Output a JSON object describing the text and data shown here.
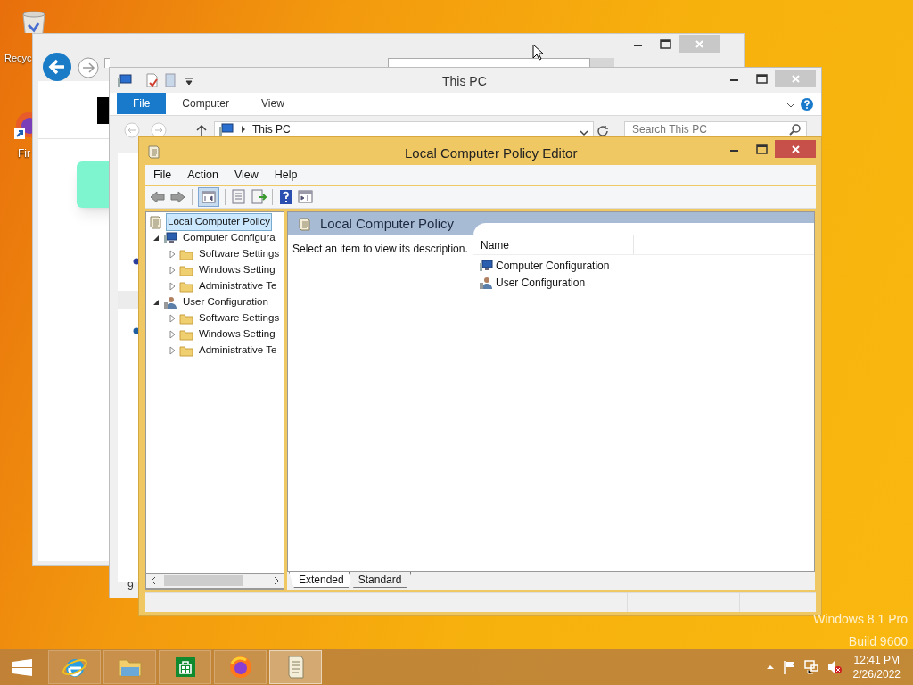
{
  "desktop_icons": [
    {
      "label": "Recyc"
    },
    {
      "label": "Fir"
    }
  ],
  "explorer_window": {
    "title": "This PC",
    "ribbon_tabs": [
      {
        "label": "File",
        "selected": true
      },
      {
        "label": "Computer",
        "selected": false
      },
      {
        "label": "View",
        "selected": false
      }
    ],
    "address": "This PC",
    "search": {
      "placeholder": "Search This PC"
    },
    "status": "9"
  },
  "policy_editor": {
    "title": "Local Computer Policy Editor",
    "menu": [
      "File",
      "Action",
      "View",
      "Help"
    ],
    "tree": [
      {
        "label": "Local Computer Policy",
        "kind": "policy",
        "selected": true,
        "children": [
          {
            "label": "Computer Configura",
            "kind": "computer",
            "selected": false,
            "expanded": true,
            "children": [
              {
                "label": "Software Settings",
                "kind": "folder",
                "selected": false,
                "expanded": false
              },
              {
                "label": "Windows Setting",
                "kind": "folder",
                "selected": false,
                "expanded": false
              },
              {
                "label": "Administrative Te",
                "kind": "folder",
                "selected": false,
                "expanded": false
              }
            ]
          },
          {
            "label": "User Configuration",
            "kind": "user",
            "selected": false,
            "expanded": true,
            "children": [
              {
                "label": "Software Settings",
                "kind": "folder",
                "selected": false,
                "expanded": false
              },
              {
                "label": "Windows Setting",
                "kind": "folder",
                "selected": false,
                "expanded": false
              },
              {
                "label": "Administrative Te",
                "kind": "folder",
                "selected": false,
                "expanded": false
              }
            ]
          }
        ]
      }
    ],
    "header": "Local Computer Policy",
    "description": "Select an item to view its description.",
    "columns": [
      "Name"
    ],
    "items": [
      {
        "label": "Computer Configuration",
        "kind": "computer"
      },
      {
        "label": "User Configuration",
        "kind": "user"
      }
    ],
    "view_tabs": [
      {
        "label": "Extended",
        "selected": true
      },
      {
        "label": "Standard",
        "selected": false
      }
    ]
  },
  "watermark": [
    "Windows 8.1 Pro",
    "Build 9600"
  ],
  "taskbar": {
    "apps": [
      {
        "kind": "ie",
        "selected": false
      },
      {
        "kind": "explorer",
        "selected": false
      },
      {
        "kind": "store",
        "selected": false
      },
      {
        "kind": "firefox",
        "selected": false
      },
      {
        "kind": "policy",
        "selected": true
      }
    ],
    "time": "12:41 PM",
    "date": "2/26/2022"
  }
}
